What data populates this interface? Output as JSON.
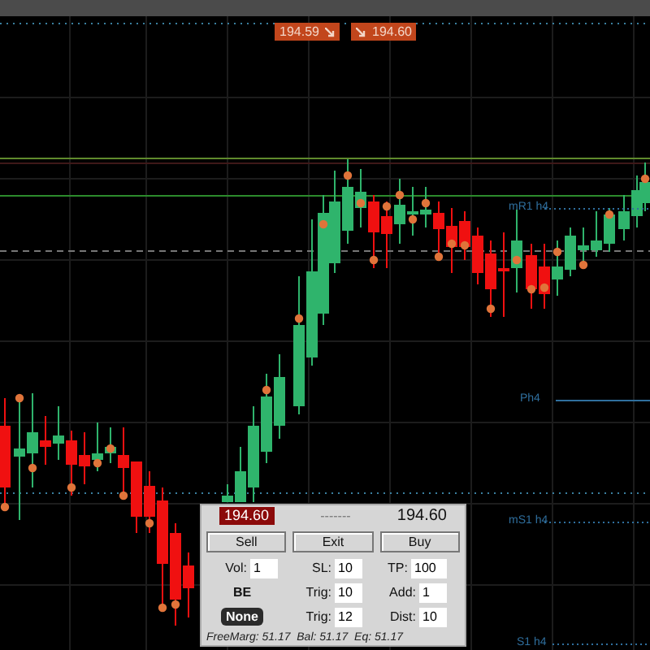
{
  "price_tags": [
    {
      "kind": "bid",
      "text": "194.59"
    },
    {
      "kind": "ask",
      "text": "194.60"
    }
  ],
  "levels": [
    {
      "label": "mR1 h4",
      "kind": "dotted"
    },
    {
      "label": "Ph4",
      "kind": "solid"
    },
    {
      "label": "mS1 h4",
      "kind": "dotted"
    },
    {
      "label": "S1 h4",
      "kind": "dotted"
    }
  ],
  "trade_panel": {
    "sell_price": "194.60",
    "spread": "-------",
    "buy_price": "194.60",
    "buttons": [
      "Sell",
      "Exit",
      "Buy"
    ],
    "cells": [
      {
        "kind": "field",
        "label": "Vol:",
        "value": "1"
      },
      {
        "kind": "field",
        "label": "SL:",
        "value": "10"
      },
      {
        "kind": "field",
        "label": "TP:",
        "value": "100"
      },
      {
        "kind": "toggle",
        "text": "BE",
        "selected": false
      },
      {
        "kind": "field",
        "label": "Trig:",
        "value": "10"
      },
      {
        "kind": "field",
        "label": "Add:",
        "value": "1"
      },
      {
        "kind": "toggle",
        "text": "None",
        "selected": true
      },
      {
        "kind": "field",
        "label": "Trig:",
        "value": "12"
      },
      {
        "kind": "field",
        "label": "Dist:",
        "value": "10"
      }
    ],
    "status": "FreeMarg: 51.17  Bal: 51.17  Eq: 51.17"
  }
}
